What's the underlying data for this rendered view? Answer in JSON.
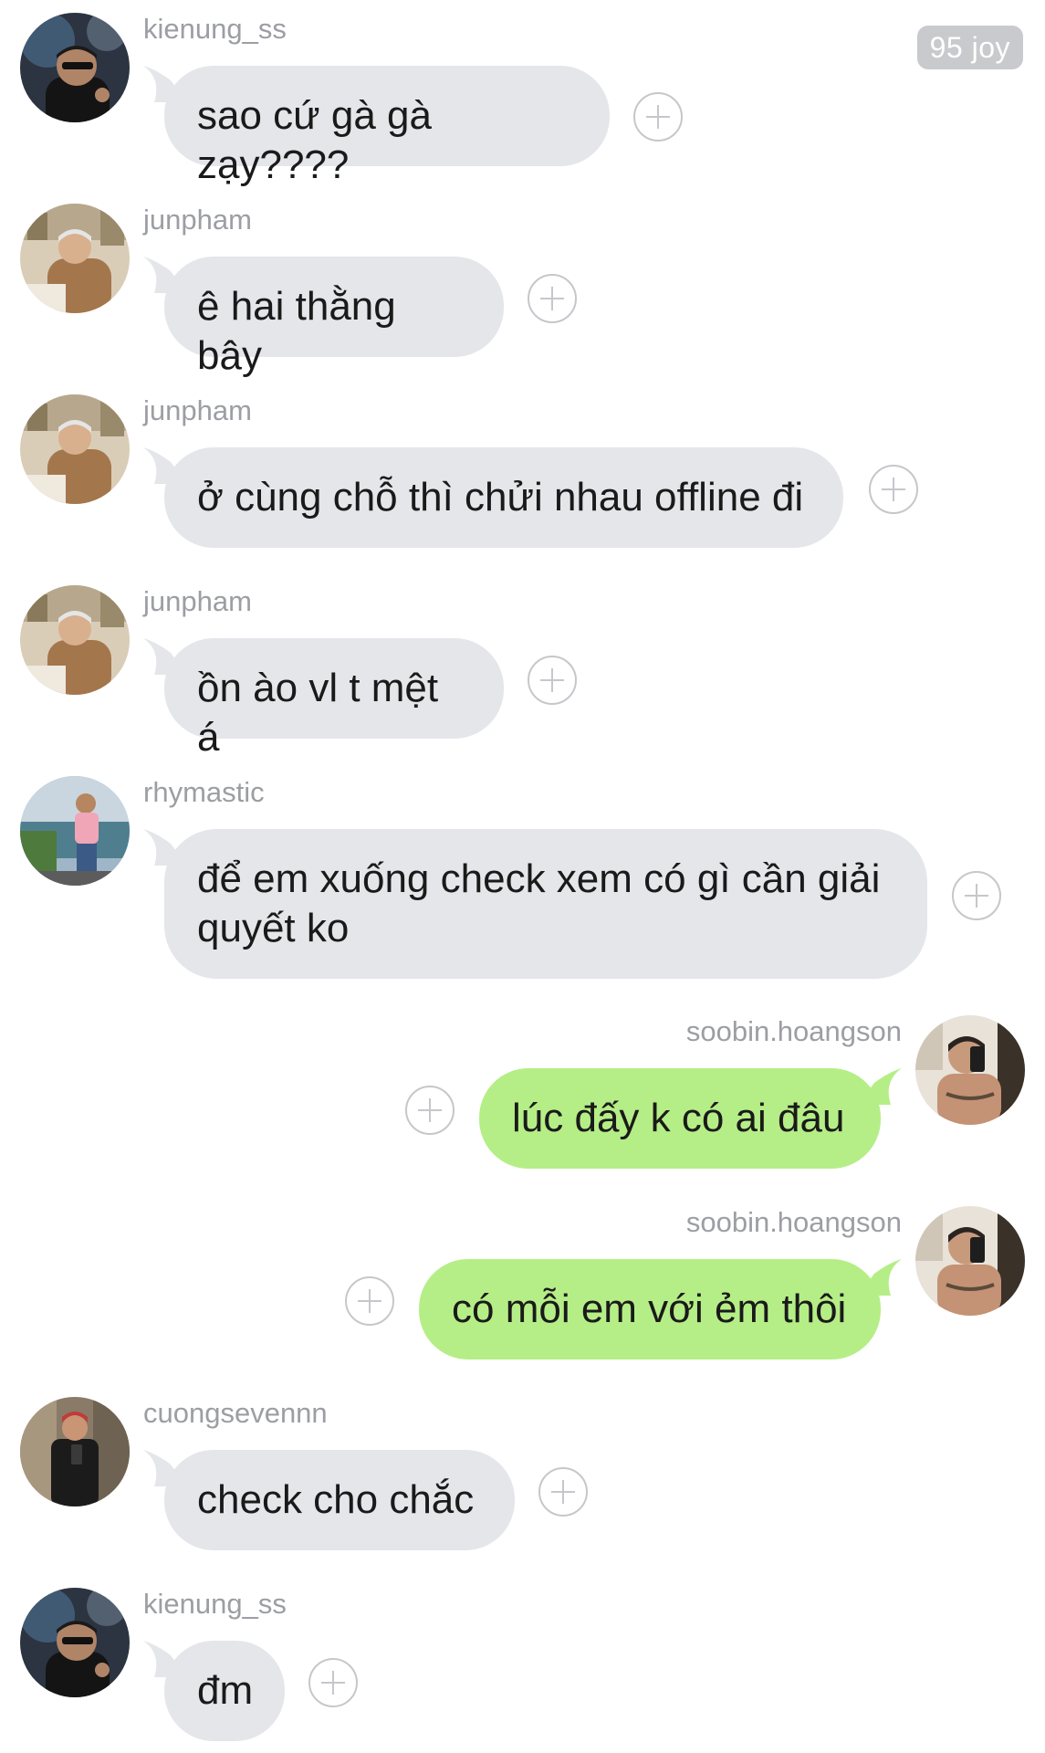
{
  "thread": {
    "joy_badge": "95 joy"
  },
  "messages": [
    {
      "user": "kienung_ss",
      "text": "sao cứ gà gà zạy????",
      "direction": "in",
      "avatar": "avatar-kienung"
    },
    {
      "user": "junpham",
      "text": "ê hai thằng bây",
      "direction": "in",
      "avatar": "avatar-junpham"
    },
    {
      "user": "junpham",
      "text": "ở cùng chỗ thì chửi nhau offline đi",
      "direction": "in",
      "avatar": "avatar-junpham"
    },
    {
      "user": "junpham",
      "text": "ồn ào vl t mệt á",
      "direction": "in",
      "avatar": "avatar-junpham"
    },
    {
      "user": "rhymastic",
      "text_line1": "để em xuống check xem có gì cần giải",
      "text_line2": "quyết ko",
      "direction": "in",
      "avatar": "avatar-rhymastic"
    },
    {
      "user": "soobin.hoangson",
      "text": "lúc đấy k có ai đâu",
      "direction": "out",
      "avatar": "avatar-soobin"
    },
    {
      "user": "soobin.hoangson",
      "text": "có mỗi em với ẻm thôi",
      "direction": "out",
      "avatar": "avatar-soobin"
    },
    {
      "user": "cuongsevennn",
      "text": "check cho chắc",
      "direction": "in",
      "avatar": "avatar-cuong"
    },
    {
      "user": "kienung_ss",
      "text": "đm",
      "direction": "in",
      "avatar": "avatar-kienung"
    }
  ],
  "colors": {
    "incoming_bubble": "#e5e6ea",
    "outgoing_bubble": "#b5ee86",
    "username": "#9c9ea3",
    "badge": "#c9cacd"
  },
  "icons": {
    "react": "plus-circle-icon"
  }
}
